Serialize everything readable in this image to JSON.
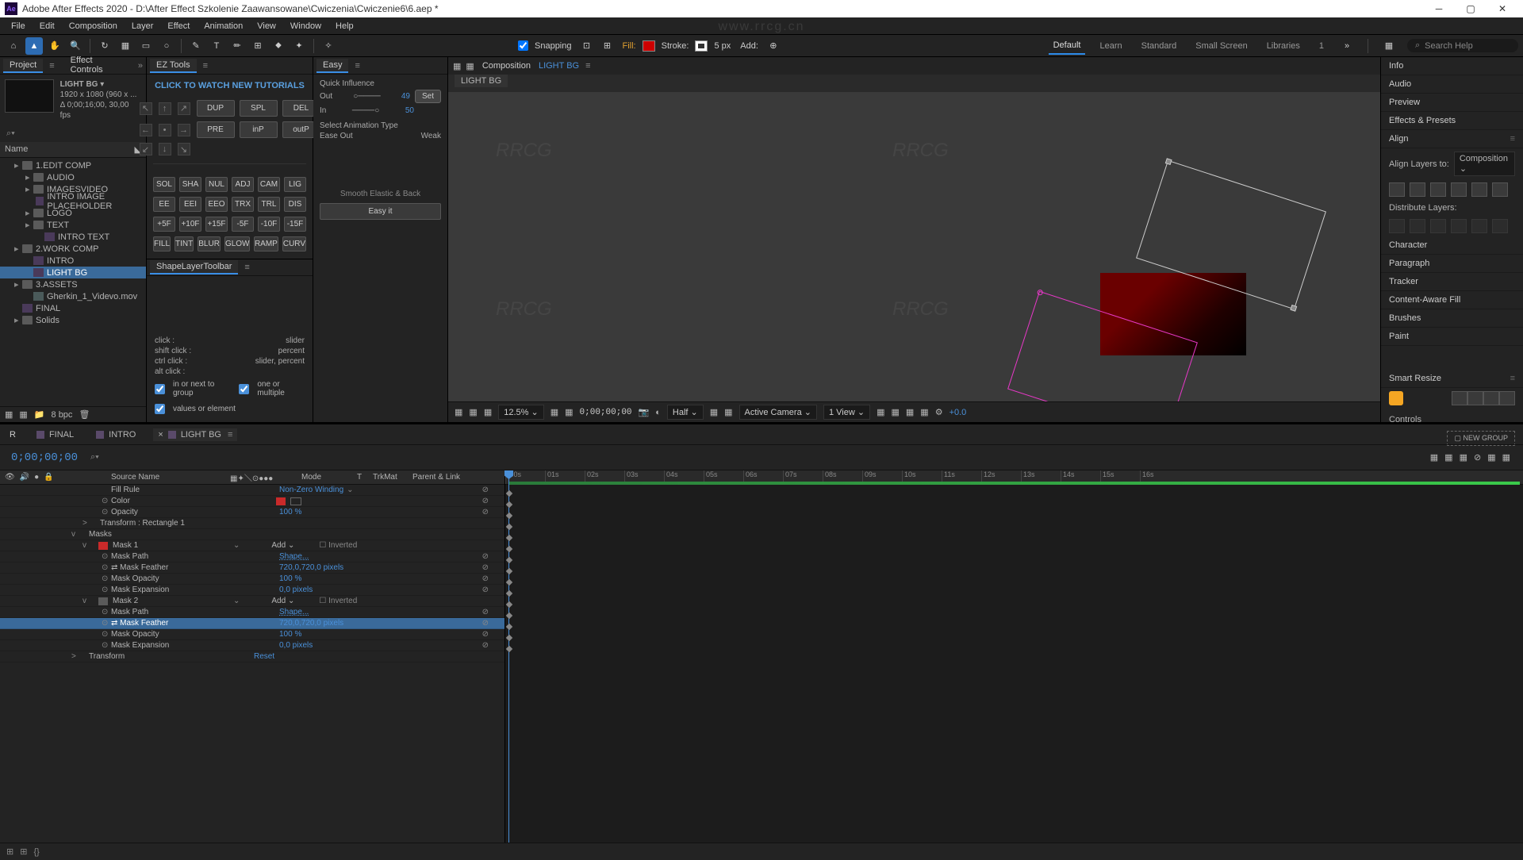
{
  "app": {
    "title": "Adobe After Effects 2020 - D:\\After Effect Szkolenie Zaawansowane\\Cwiczenia\\Cwiczenie6\\6.aep *",
    "watermark_url": "www.rrcg.cn"
  },
  "menu": [
    "File",
    "Edit",
    "Composition",
    "Layer",
    "Effect",
    "Animation",
    "View",
    "Window",
    "Help"
  ],
  "toolbar": {
    "snapping": "Snapping",
    "fill": "Fill:",
    "stroke": "Stroke:",
    "stroke_width": "5 px",
    "add": "Add:",
    "search_placeholder": "Search Help"
  },
  "workspaces": [
    "Default",
    "Learn",
    "Standard",
    "Small Screen",
    "Libraries",
    "1"
  ],
  "project": {
    "tab_project": "Project",
    "tab_effect_controls": "Effect Controls",
    "comp_name": "LIGHT BG",
    "res": "1920 x 1080  (960 x ...",
    "dur": "Δ 0;00;16;00, 30,00 fps",
    "name_header": "Name",
    "bpc": "8 bpc",
    "tree": [
      {
        "name": "1.EDIT COMP",
        "type": "folder",
        "indent": 1
      },
      {
        "name": "AUDIO",
        "type": "folder",
        "indent": 2
      },
      {
        "name": "IMAGESVIDEO",
        "type": "folder",
        "indent": 2
      },
      {
        "name": "INTRO IMAGE PLACEHOLDER",
        "type": "comp",
        "indent": 3
      },
      {
        "name": "LOGO",
        "type": "folder",
        "indent": 2
      },
      {
        "name": "TEXT",
        "type": "folder",
        "indent": 2
      },
      {
        "name": "INTRO TEXT",
        "type": "comp",
        "indent": 3
      },
      {
        "name": "2.WORK COMP",
        "type": "folder",
        "indent": 1
      },
      {
        "name": "INTRO",
        "type": "comp",
        "indent": 2
      },
      {
        "name": "LIGHT BG",
        "type": "comp",
        "indent": 2,
        "sel": true
      },
      {
        "name": "3.ASSETS",
        "type": "folder",
        "indent": 1
      },
      {
        "name": "Gherkin_1_Videvo.mov",
        "type": "foot",
        "indent": 2
      },
      {
        "name": "FINAL",
        "type": "comp",
        "indent": 1
      },
      {
        "name": "Solids",
        "type": "folder",
        "indent": 1
      }
    ]
  },
  "ez": {
    "tab": "EZ Tools",
    "banner": "CLICK TO WATCH NEW TUTORIALS",
    "btns1": [
      "DUP",
      "SPL",
      "DEL"
    ],
    "btns2": [
      "PRE",
      "inP",
      "outP"
    ],
    "row1": [
      "SOL",
      "SHA",
      "NUL",
      "ADJ",
      "CAM",
      "LIG"
    ],
    "row2": [
      "EE",
      "EEI",
      "EEO",
      "TRX",
      "TRL",
      "DIS"
    ],
    "row3": [
      "+5F",
      "+10F",
      "+15F",
      "-5F",
      "-10F",
      "-15F"
    ],
    "row4": [
      "FILL",
      "TINT",
      "BLUR",
      "GLOW",
      "RAMP",
      "CURV"
    ]
  },
  "easy": {
    "tab": "Easy",
    "quick": "Quick Influence",
    "out": "Out",
    "out_val": "49",
    "in": "In",
    "in_val": "50",
    "set": "Set",
    "sel_type": "Select Animation Type",
    "ease_out": "Ease Out",
    "weak": "Weak",
    "smooth": "Smooth Elastic & Back",
    "easy_it": "Easy it"
  },
  "shape": {
    "tab": "ShapeLayerToolbar",
    "kv": [
      {
        "k": "click :",
        "v": "slider"
      },
      {
        "k": "shift click :",
        "v": "percent"
      },
      {
        "k": "ctrl click :",
        "v": "slider, percent"
      },
      {
        "k": "alt click :",
        "v": ""
      }
    ],
    "chk1": "in or next to group",
    "chk2": "one or multiple",
    "chk3": "values or element"
  },
  "viewer": {
    "prefix": "Composition",
    "name": "LIGHT BG",
    "tab": "LIGHT BG",
    "zoom": "12.5%",
    "tc": "0;00;00;00",
    "quality": "Half",
    "camera": "Active Camera",
    "view": "1 View",
    "exposure": "+0.0"
  },
  "right_panels": [
    "Info",
    "Audio",
    "Preview",
    "Effects & Presets",
    "Align",
    "Character",
    "Paragraph",
    "Tracker",
    "Content-Aware Fill",
    "Brushes",
    "Paint"
  ],
  "align": {
    "label": "Align Layers to:",
    "target": "Composition",
    "distribute": "Distribute Layers:"
  },
  "smart": {
    "title": "Smart Resize",
    "controls": "Controls",
    "new_group": "NEW GROUP"
  },
  "timeline": {
    "tabs": [
      "FINAL",
      "INTRO",
      "LIGHT BG"
    ],
    "r": "R",
    "tc": "0;00;00;00",
    "cols": {
      "source": "Source Name",
      "mode": "Mode",
      "t": "T",
      "trkmat": "TrkMat",
      "parent": "Parent & Link"
    },
    "ruler": [
      ":00s",
      "01s",
      "02s",
      "03s",
      "04s",
      "05s",
      "06s",
      "07s",
      "08s",
      "09s",
      "10s",
      "11s",
      "12s",
      "13s",
      "14s",
      "15s",
      "16s"
    ],
    "layers": [
      {
        "indent": 2,
        "name": "Fill Rule",
        "val": "Non-Zero Winding",
        "dd": true,
        "link": true
      },
      {
        "indent": 2,
        "name": "Color",
        "stop": true,
        "swatch": true,
        "link": true
      },
      {
        "indent": 2,
        "name": "Opacity",
        "stop": true,
        "val": "100 %",
        "link": true
      },
      {
        "indent": 1,
        "name": "Transform : Rectangle 1",
        "arrow": ">"
      },
      {
        "indent": 0,
        "name": "Masks",
        "arrow": "v"
      },
      {
        "indent": 1,
        "name": "Mask 1",
        "arrow": "v",
        "sw": true,
        "mode": "Add",
        "dd": true,
        "inv": "Inverted"
      },
      {
        "indent": 2,
        "name": "Mask Path",
        "stop": true,
        "val": "Shape...",
        "u": true,
        "link": true
      },
      {
        "indent": 2,
        "name": "Mask Feather",
        "stop": true,
        "chain": true,
        "val": "720,0,720,0 pixels",
        "link": true
      },
      {
        "indent": 2,
        "name": "Mask Opacity",
        "stop": true,
        "val": "100 %",
        "link": true
      },
      {
        "indent": 2,
        "name": "Mask Expansion",
        "stop": true,
        "val": "0,0 pixels",
        "link": true
      },
      {
        "indent": 1,
        "name": "Mask 2",
        "arrow": "v",
        "sw": true,
        "pink": true,
        "mode": "Add",
        "dd": true,
        "inv": "Inverted"
      },
      {
        "indent": 2,
        "name": "Mask Path",
        "stop": true,
        "val": "Shape...",
        "u": true,
        "link": true
      },
      {
        "indent": 2,
        "name": "Mask Feather",
        "stop": true,
        "chain": true,
        "val": "720,0,720,0 pixels",
        "link": true,
        "sel": true
      },
      {
        "indent": 2,
        "name": "Mask Opacity",
        "stop": true,
        "val": "100 %",
        "link": true
      },
      {
        "indent": 2,
        "name": "Mask Expansion",
        "stop": true,
        "val": "0,0 pixels",
        "link": true
      },
      {
        "indent": 0,
        "name": "Transform",
        "arrow": ">",
        "reset": "Reset"
      }
    ]
  }
}
